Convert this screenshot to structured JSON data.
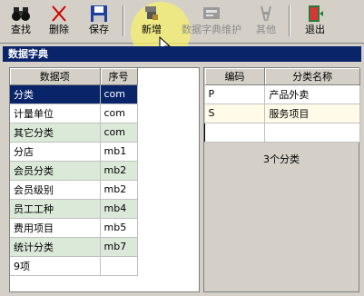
{
  "toolbar": {
    "buttons": [
      {
        "label": "查找",
        "icon": "binoculars-icon"
      },
      {
        "label": "删除",
        "icon": "delete-x-icon"
      },
      {
        "label": "保存",
        "icon": "floppy-disk-icon"
      },
      {
        "label": "新增",
        "icon": "new-item-icon"
      },
      {
        "label": "数据字典维护",
        "icon": "dictionary-icon"
      },
      {
        "label": "其他",
        "icon": "tools-icon"
      },
      {
        "label": "退出",
        "icon": "exit-door-icon"
      }
    ]
  },
  "window": {
    "title": "数据字典"
  },
  "left_table": {
    "headers": [
      "数据项",
      "序号"
    ],
    "rows": [
      [
        "分类",
        "com"
      ],
      [
        "计量单位",
        "com"
      ],
      [
        "其它分类",
        "com"
      ],
      [
        "分店",
        "mb1"
      ],
      [
        "会员分类",
        "mb2"
      ],
      [
        "会员级别",
        "mb2"
      ],
      [
        "员工工种",
        "mb4"
      ],
      [
        "费用项目",
        "mb5"
      ],
      [
        "统计分类",
        "mb7"
      ],
      [
        "9项",
        ""
      ]
    ]
  },
  "right_table": {
    "headers": [
      "编码",
      "分类名称"
    ],
    "rows": [
      [
        "P",
        "产品外卖"
      ],
      [
        "S",
        "服务项目"
      ],
      [
        "",
        ""
      ]
    ],
    "footer": "3个分类"
  },
  "colors": {
    "selection": "#0a246a",
    "row_alt": "#dbe9d9",
    "highlight": "#f6f06e"
  }
}
